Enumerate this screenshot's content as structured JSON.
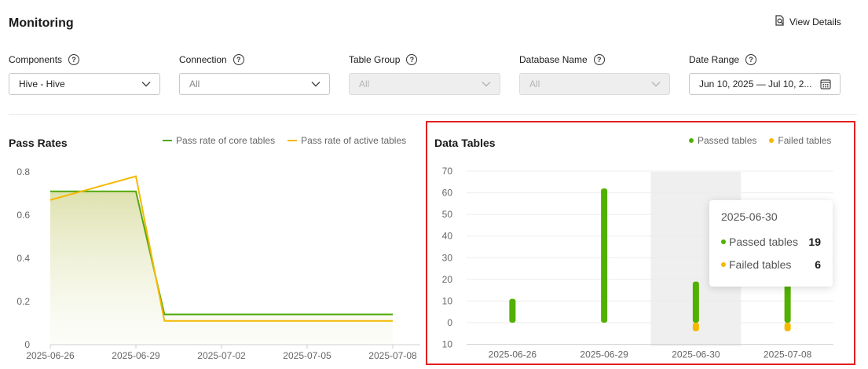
{
  "page": {
    "title": "Monitoring",
    "view_details": "View Details"
  },
  "filters": [
    {
      "label": "Components",
      "value": "Hive - Hive",
      "placeholder": false,
      "disabled": false,
      "icon": "chevron-down-icon"
    },
    {
      "label": "Connection",
      "value": "All",
      "placeholder": true,
      "disabled": false,
      "icon": "chevron-down-icon"
    },
    {
      "label": "Table Group",
      "value": "All",
      "placeholder": true,
      "disabled": true,
      "icon": "chevron-down-icon"
    },
    {
      "label": "Database Name",
      "value": "All",
      "placeholder": true,
      "disabled": true,
      "icon": "chevron-down-icon"
    },
    {
      "label": "Date Range",
      "value": "Jun 10, 2025 — Jul 10, 2...",
      "placeholder": false,
      "disabled": false,
      "icon": "calendar-icon"
    }
  ],
  "pass_rates": {
    "title": "Pass Rates",
    "legend": [
      "Pass rate of core tables",
      "Pass rate of active tables"
    ]
  },
  "data_tables": {
    "title": "Data Tables",
    "legend": [
      "Passed tables",
      "Failed tables"
    ],
    "tooltip": {
      "date": "2025-06-30",
      "passed_label": "Passed tables",
      "passed_value": "19",
      "failed_label": "Failed tables",
      "failed_value": "6"
    }
  },
  "colors": {
    "core": "#52a80a",
    "active": "#f5b800",
    "passed": "#52b000",
    "failed": "#f5b800",
    "highlight": "#e02020"
  },
  "chart_data": [
    {
      "type": "line",
      "title": "Pass Rates",
      "x": [
        "2025-06-26",
        "2025-06-29",
        "2025-07-02",
        "2025-07-05",
        "2025-07-08"
      ],
      "x_positions": [
        0,
        3,
        6,
        9,
        12
      ],
      "ylim": [
        0,
        0.8
      ],
      "yticks": [
        0,
        0.2,
        0.4,
        0.6,
        0.8
      ],
      "series": [
        {
          "name": "Pass rate of core tables",
          "points": [
            [
              0,
              0.71
            ],
            [
              3,
              0.71
            ],
            [
              4,
              0.14
            ],
            [
              12,
              0.14
            ]
          ]
        },
        {
          "name": "Pass rate of active tables",
          "points": [
            [
              0,
              0.67
            ],
            [
              3,
              0.78
            ],
            [
              4,
              0.11
            ],
            [
              12,
              0.11
            ]
          ]
        }
      ],
      "grid": false
    },
    {
      "type": "bar",
      "title": "Data Tables",
      "categories": [
        "2025-06-26",
        "2025-06-29",
        "2025-06-30",
        "2025-07-08"
      ],
      "ylim": [
        -10,
        70
      ],
      "yticks": [
        70,
        60,
        50,
        40,
        30,
        20,
        10,
        0,
        10
      ],
      "series": [
        {
          "name": "Passed tables",
          "values": [
            11,
            62,
            19,
            19
          ]
        },
        {
          "name": "Failed tables",
          "values": [
            0,
            0,
            6,
            6
          ]
        }
      ],
      "highlight_category": "2025-06-30",
      "grid": true
    }
  ]
}
